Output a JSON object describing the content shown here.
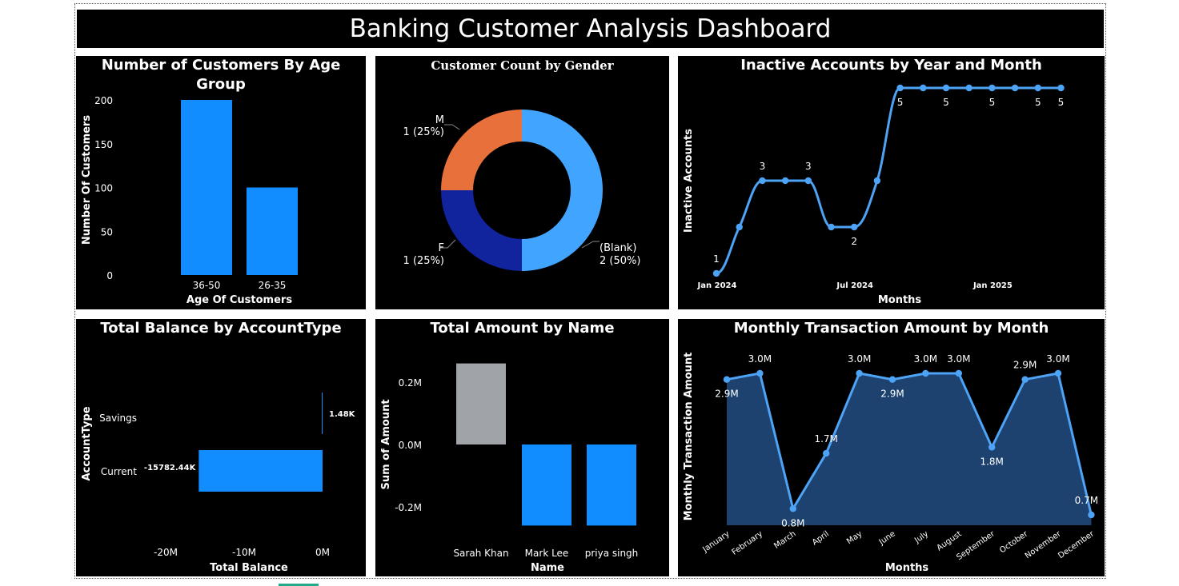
{
  "page": {
    "title": "Banking Customer Analysis Dashboard"
  },
  "colors": {
    "accent": "#118DFF",
    "line": "#4DA3F5",
    "gray": "#A0A4A8",
    "orange": "#E8703A",
    "navy": "#12239E",
    "lightblue": "#41A4FF",
    "area": "#1E4270"
  },
  "chart_data": [
    {
      "type": "bar",
      "title": "Number of Customers By Age Group",
      "xlabel": "Age Of Customers",
      "ylabel": "Number Of Customers",
      "categories": [
        "36-50",
        "26-35"
      ],
      "values": [
        200,
        100
      ],
      "ylim": [
        0,
        200
      ],
      "yticks": [
        "0",
        "50",
        "100",
        "150",
        "200"
      ],
      "grid": false
    },
    {
      "type": "pie",
      "title": "Customer Count by Gender",
      "donut": true,
      "slices": [
        {
          "label": "(Blank)",
          "value": 2,
          "display": "2 (50%)",
          "color": "#41A4FF"
        },
        {
          "label": "F",
          "value": 1,
          "display": "1 (25%)",
          "color": "#12239E"
        },
        {
          "label": "M",
          "value": 1,
          "display": "1 (25%)",
          "color": "#E8703A"
        }
      ]
    },
    {
      "type": "line",
      "title": "Inactive Accounts by Year and Month",
      "xlabel": "Months",
      "ylabel": "Inactive Accounts",
      "x": [
        "2024-01",
        "2024-02",
        "2024-03",
        "2024-04",
        "2024-05",
        "2024-06",
        "2024-07",
        "2024-08",
        "2024-09",
        "2024-10",
        "2024-11",
        "2024-12",
        "2025-01",
        "2025-02",
        "2025-03",
        "2025-04"
      ],
      "values": [
        1,
        2,
        3,
        3,
        3,
        2,
        2,
        3,
        5,
        5,
        5,
        5,
        5,
        5,
        5,
        5
      ],
      "data_labels": [
        {
          "index": 0,
          "text": "1"
        },
        {
          "index": 2,
          "text": "3"
        },
        {
          "index": 4,
          "text": "3"
        },
        {
          "index": 6,
          "text": "2"
        },
        {
          "index": 8,
          "text": "5"
        },
        {
          "index": 10,
          "text": "5"
        },
        {
          "index": 12,
          "text": "5"
        },
        {
          "index": 14,
          "text": "5"
        },
        {
          "index": 15,
          "text": "5"
        }
      ],
      "xtick_labels": [
        {
          "index": 0,
          "text": "Jan 2024"
        },
        {
          "index": 6,
          "text": "Jul 2024"
        },
        {
          "index": 12,
          "text": "Jan 2025"
        }
      ]
    },
    {
      "type": "bar",
      "orientation": "horizontal",
      "title": "Total Balance by AccountType",
      "xlabel": "Total Balance",
      "ylabel": "AccountType",
      "categories": [
        "Savings",
        "Current"
      ],
      "values": [
        1.48,
        -15782.44
      ],
      "units": "K",
      "data_labels": [
        "1.48K",
        "-15782.44K"
      ],
      "xlim": [
        -20000,
        0
      ],
      "xticks": [
        "-20M",
        "-10M",
        "0M"
      ]
    },
    {
      "type": "bar",
      "title": "Total Amount by Name",
      "xlabel": "Name",
      "ylabel": "Sum of Amount",
      "categories": [
        "Sarah Khan",
        "Mark Lee",
        "priya singh"
      ],
      "values": [
        0.26,
        -0.26,
        -0.26
      ],
      "units": "M",
      "bar_colors": [
        "#A0A4A8",
        "#118DFF",
        "#118DFF"
      ],
      "yticks": [
        "0.2M",
        "0.0M",
        "-0.2M"
      ],
      "ylim": [
        -0.3,
        0.3
      ]
    },
    {
      "type": "area",
      "title": "Monthly Transaction Amount by Month",
      "xlabel": "Months",
      "ylabel": "Monthly Transaction Amount",
      "categories": [
        "January",
        "February",
        "March",
        "April",
        "May",
        "June",
        "July",
        "August",
        "September",
        "October",
        "November",
        "December"
      ],
      "values": [
        2.9,
        3.0,
        0.8,
        1.7,
        3.0,
        2.9,
        3.0,
        3.0,
        1.8,
        2.9,
        3.0,
        0.7
      ],
      "data_labels": [
        "2.9M",
        "3.0M",
        "0.8M",
        "1.7M",
        "3.0M",
        "2.9M",
        "3.0M",
        "3.0M",
        "1.8M",
        "2.9M",
        "3.0M",
        "0.7M"
      ],
      "units": "M"
    }
  ]
}
